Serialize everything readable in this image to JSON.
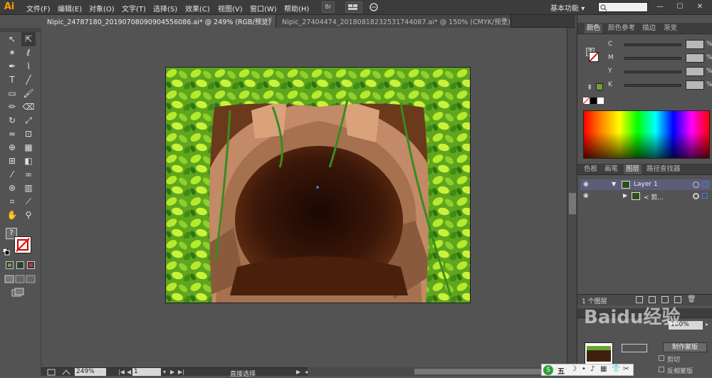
{
  "app": {
    "logo": "Ai"
  },
  "menu": [
    "文件(F)",
    "编辑(E)",
    "对象(O)",
    "文字(T)",
    "选择(S)",
    "效果(C)",
    "视图(V)",
    "窗口(W)",
    "帮助(H)"
  ],
  "menu_buttons": {
    "br": "Br"
  },
  "workspace": {
    "label": "基本功能",
    "arrow": "▾"
  },
  "window_controls": {
    "minimize": "—",
    "maximize": "☐",
    "close": "✕"
  },
  "tabs": [
    {
      "label": "Nipic_24787180_20190708090904556086.ai* @ 249% (RGB/预览)",
      "close": "×",
      "active": true
    },
    {
      "label": "Nipic_27404474_20180818232531744087.ai* @ 150% (CMYK/预览)",
      "close": "×",
      "active": false
    }
  ],
  "tools": [
    {
      "name": "selection-tool",
      "glyph": "↖"
    },
    {
      "name": "direct-selection-tool",
      "glyph": "⇱"
    },
    {
      "name": "magic-wand-tool",
      "glyph": "✶"
    },
    {
      "name": "lasso-tool",
      "glyph": "ℓ"
    },
    {
      "name": "pen-tool",
      "glyph": "✒"
    },
    {
      "name": "curvature-tool",
      "glyph": "⌇"
    },
    {
      "name": "type-tool",
      "glyph": "T"
    },
    {
      "name": "line-tool",
      "glyph": "╱"
    },
    {
      "name": "rectangle-tool",
      "glyph": "▭"
    },
    {
      "name": "paintbrush-tool",
      "glyph": "🖌"
    },
    {
      "name": "pencil-tool",
      "glyph": "✏"
    },
    {
      "name": "eraser-tool",
      "glyph": "⌫"
    },
    {
      "name": "rotate-tool",
      "glyph": "↻"
    },
    {
      "name": "scale-tool",
      "glyph": "⤢"
    },
    {
      "name": "warp-tool",
      "glyph": "≈"
    },
    {
      "name": "free-transform-tool",
      "glyph": "⊡"
    },
    {
      "name": "shape-builder-tool",
      "glyph": "⊕"
    },
    {
      "name": "perspective-grid-tool",
      "glyph": "▦"
    },
    {
      "name": "mesh-tool",
      "glyph": "⊞"
    },
    {
      "name": "gradient-tool",
      "glyph": "◧"
    },
    {
      "name": "eyedropper-tool",
      "glyph": "⁄"
    },
    {
      "name": "blend-tool",
      "glyph": "∞"
    },
    {
      "name": "symbol-sprayer-tool",
      "glyph": "⊛"
    },
    {
      "name": "column-graph-tool",
      "glyph": "▥"
    },
    {
      "name": "artboard-tool",
      "glyph": "⌗"
    },
    {
      "name": "slice-tool",
      "glyph": "⟋"
    },
    {
      "name": "hand-tool",
      "glyph": "✋"
    },
    {
      "name": "zoom-tool",
      "glyph": "⚲"
    }
  ],
  "color_panel": {
    "tabs": [
      "颜色",
      "颜色参考",
      "描边",
      "渐变"
    ],
    "question": "?",
    "rows": [
      {
        "label": "C",
        "value": "",
        "unit": "%"
      },
      {
        "label": "M",
        "value": "",
        "unit": "%"
      },
      {
        "label": "Y",
        "value": "",
        "unit": "%"
      },
      {
        "label": "K",
        "value": "",
        "unit": "%"
      }
    ]
  },
  "layers_panel": {
    "tabs": [
      "色板",
      "画笔",
      "图层",
      "路径查找器"
    ],
    "layers": [
      {
        "name": "Layer 1",
        "expand": "▼"
      },
      {
        "name": "< 剪...",
        "expand": "▶"
      }
    ],
    "footer": "1 个图层"
  },
  "transparency_panel": {
    "opacity": "100%",
    "make_mask": "制作蒙版",
    "clip": "剪切",
    "invert_mask": "反相蒙版"
  },
  "status": {
    "zoom": "249%",
    "page": "1",
    "tool_name": "直接选择"
  },
  "taskbar": {
    "ime": "五",
    "items": [
      "☽",
      "•",
      "♪",
      "▦",
      "👕",
      "✂"
    ]
  },
  "watermark": "Baidu经验",
  "colors": {
    "accent_swatch": "#6aa532",
    "artwork_leaf_light": "#a8e022",
    "artwork_leaf_dark": "#2f7d14",
    "artwork_rock": "#b98463",
    "artwork_cave": "#2a1208"
  }
}
